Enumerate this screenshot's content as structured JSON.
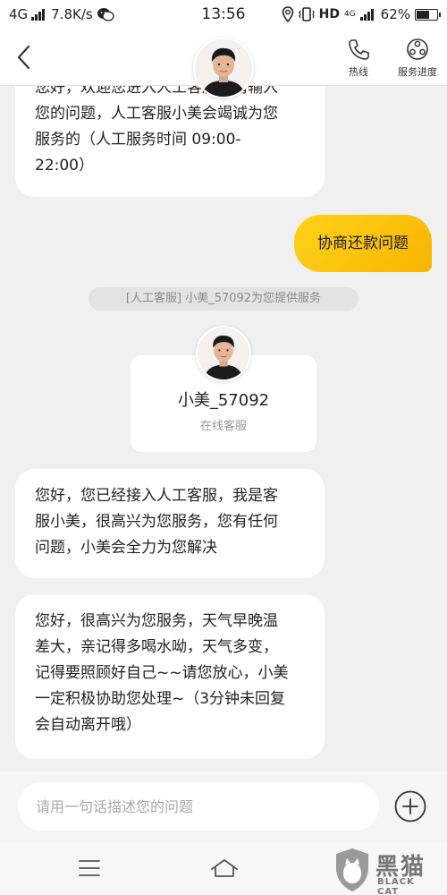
{
  "status_bar": {
    "network": "4G",
    "speed": "7.8K/s",
    "time": "13:56",
    "hd": "HD",
    "network_sub": "4G",
    "battery_text": "62%",
    "battery_level": 0.62
  },
  "nav": {
    "back_icon": "chevron-left-icon",
    "hotline_label": "热线",
    "progress_label": "服务进度"
  },
  "messages": [
    {
      "side": "in",
      "lines": [
        "您好，欢迎您进入人工客服，请输入",
        "您的问题，人工客服小美会竭诚为您",
        "服务的（人工服务时间 09:00-",
        "22:00）"
      ]
    },
    {
      "side": "out",
      "text": "协商还款问题"
    },
    {
      "side": "system",
      "text": "[人工客服] 小美_57092为您提供服务"
    },
    {
      "side": "in",
      "lines": [
        "您好，您已经接入人工客服，我是客",
        "服小美，很高兴为您服务，您有任何",
        "问题，小美会全力为您解决"
      ]
    },
    {
      "side": "in",
      "lines": [
        "您好，很高兴为您服务，天气早晚温",
        "差大，亲记得多喝水呦，天气多变，",
        "记得要照顾好自己~~请您放心，小美",
        "一定积极协助您处理~（3分钟未回复",
        "会自动离开哦）"
      ]
    }
  ],
  "agent_card": {
    "name": "小美_57092",
    "role": "在线客服"
  },
  "input": {
    "placeholder": "请用一句话描述您的问题",
    "value": ""
  },
  "watermark": {
    "text": "黑猫",
    "sub": "BLACK CAT"
  },
  "colors": {
    "accent": "#f7b500",
    "accent_light": "#ffd21a",
    "bubble_bg": "#ffffff",
    "chat_bg": "#f0f0f0"
  }
}
